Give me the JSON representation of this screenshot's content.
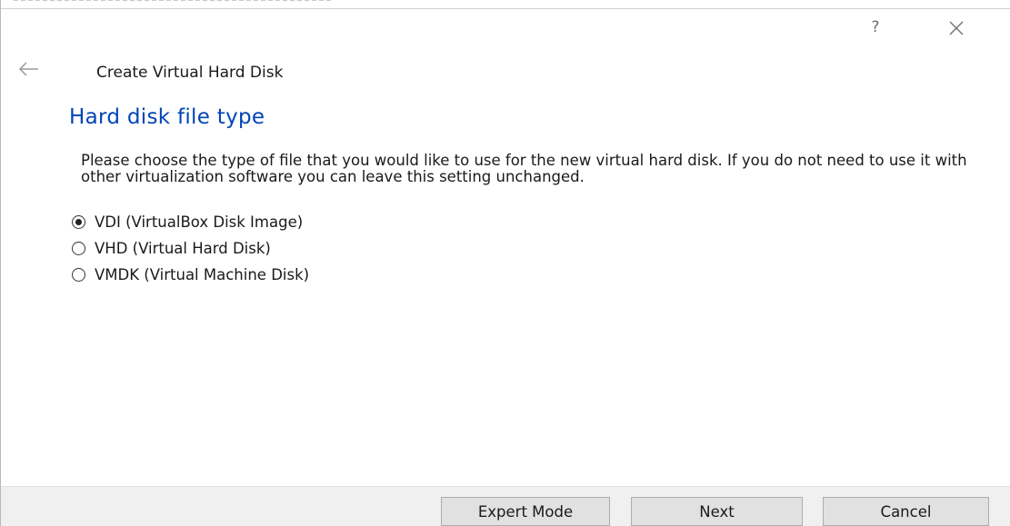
{
  "dialog": {
    "help_glyph": "?",
    "wizard_title": "Create Virtual Hard Disk"
  },
  "page": {
    "heading": "Hard disk file type",
    "description": "Please choose the type of file that you would like to use for the new virtual hard disk. If you do not need to use it with other virtualization software you can leave this setting unchanged."
  },
  "options": [
    {
      "label": "VDI (VirtualBox Disk Image)",
      "checked": true
    },
    {
      "label": "VHD (Virtual Hard Disk)",
      "checked": false
    },
    {
      "label": "VMDK (Virtual Machine Disk)",
      "checked": false
    }
  ],
  "buttons": {
    "expert_mode": "Expert Mode",
    "next": "Next",
    "cancel": "Cancel"
  },
  "icons": {
    "help": "help-icon",
    "close": "close-icon",
    "back": "back-arrow-icon"
  },
  "colors": {
    "heading": "#0044b8",
    "footer_bg": "#f0f0f0",
    "button_bg": "#e1e1e1"
  }
}
